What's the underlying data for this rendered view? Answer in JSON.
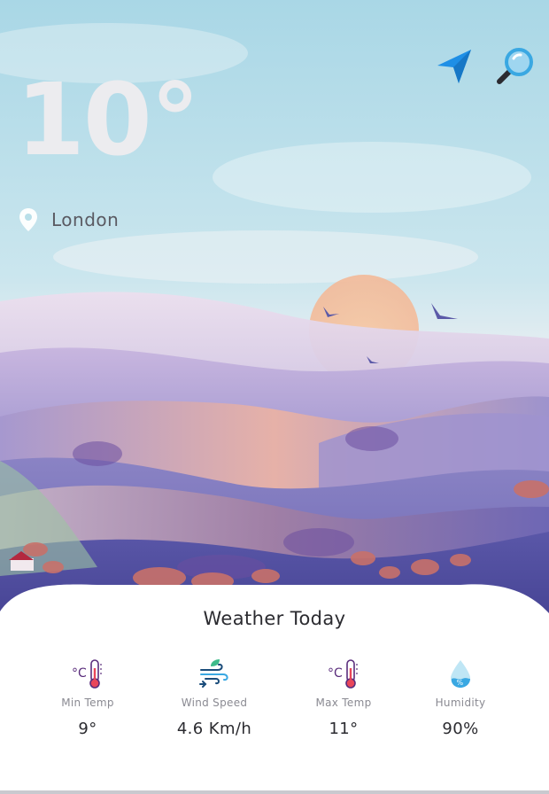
{
  "weather": {
    "temperature": "10°",
    "location": "London"
  },
  "today": {
    "title": "Weather Today",
    "stats": [
      {
        "label": "Min Temp",
        "value": "9°",
        "icon": "thermometer-icon"
      },
      {
        "label": "Wind Speed",
        "value": "4.6 Km/h",
        "icon": "wind-icon"
      },
      {
        "label": "Max Temp",
        "value": "11°",
        "icon": "thermometer-icon"
      },
      {
        "label": "Humidity",
        "value": "90%",
        "icon": "humidity-drop-icon"
      }
    ]
  },
  "colors": {
    "sky_top": "#a9d7e6",
    "sunset": "#f3c7a4",
    "hills_purple": "#8d86c3",
    "navigate_blue": "#1e8fe6",
    "thermo_red": "#e9465a",
    "humidity_blue": "#5cc0e6"
  },
  "icons": {
    "navigate": "navigation-arrow-icon",
    "search": "magnifier-icon",
    "location": "location-pin-icon"
  }
}
